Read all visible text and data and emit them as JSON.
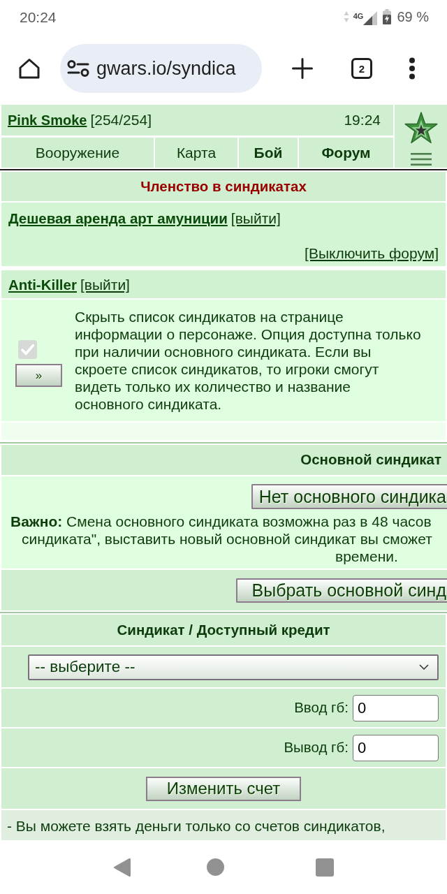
{
  "status_bar": {
    "time": "20:24",
    "network": "4G",
    "battery": "69 %"
  },
  "browser": {
    "url": "gwars.io/syndica",
    "tab_count": "2"
  },
  "header": {
    "player": "Pink Smoke",
    "hp": "[254/254]",
    "time": "19:24",
    "nav": [
      {
        "label": "Вооружение",
        "highlighted": false
      },
      {
        "label": "Карта",
        "highlighted": false
      },
      {
        "label": "Бой",
        "highlighted": true
      },
      {
        "label": "Форум",
        "highlighted": true
      }
    ]
  },
  "membership": {
    "title": "Членство в синдикатах",
    "syndicates": [
      {
        "name": "Дешевая аренда арт амуниции",
        "leave": "[выйти]",
        "forum_toggle": "[Выключить форум]"
      },
      {
        "name": "Anti-Killer",
        "leave": "[выйти]"
      }
    ],
    "hide_option": {
      "checked": true,
      "disabled": true,
      "button": "»",
      "text": "Скрыть список синдикатов на странице информации о персонаже. Опция доступна только при наличии основного синдиката. Если вы скроете список синдикатов, то игроки смогут видеть только их количество и название основного синдиката."
    }
  },
  "main_syndicate": {
    "title": "Основной синдикат",
    "current": "Нет основного синдика",
    "notice": [
      "**Важно:** Смена основного синдиката возможна раз в 48 часов",
      "синдиката\", выставить новый основной синдикат вы сможет",
      "времени."
    ],
    "button": "Выбрать основной синд"
  },
  "credit": {
    "title": "Синдикат / Доступный кредит",
    "select": "-- выберите --",
    "fields": [
      {
        "label": "Ввод гб:",
        "value": "0"
      },
      {
        "label": "Вывод гб:",
        "value": "0"
      }
    ],
    "button": "Изменить счет",
    "note": "- Вы можете взять деньги только со счетов синдикатов,"
  }
}
